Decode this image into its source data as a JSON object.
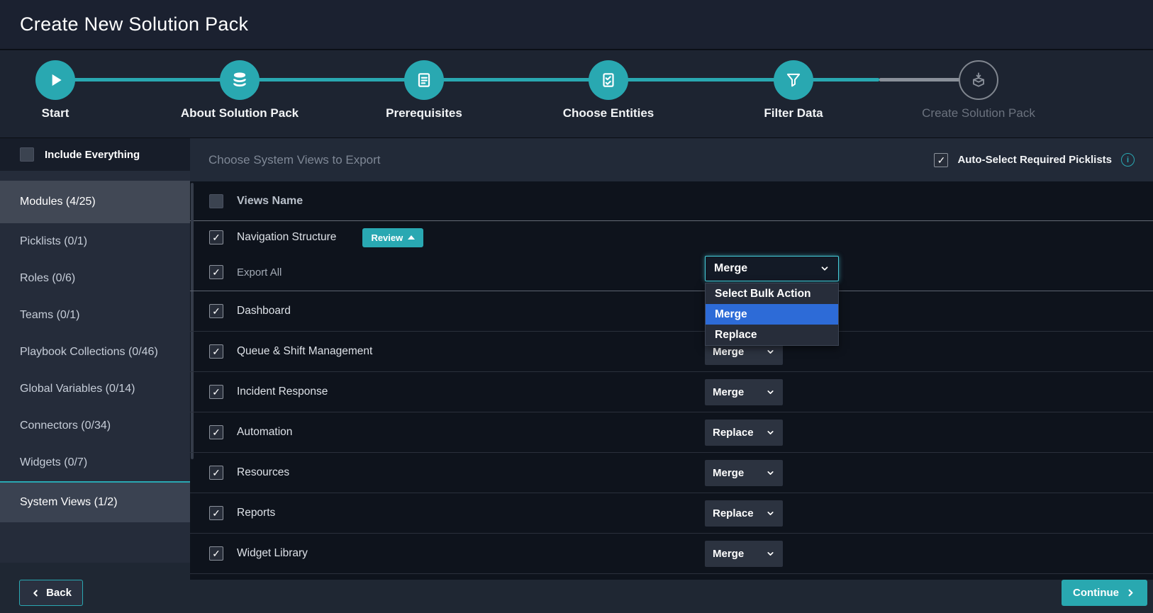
{
  "title": "Create New Solution Pack",
  "stepper": {
    "steps": [
      {
        "label": "Start",
        "icon": "play-icon",
        "state": "done"
      },
      {
        "label": "About Solution Pack",
        "icon": "database-icon",
        "state": "done"
      },
      {
        "label": "Prerequisites",
        "icon": "document-icon",
        "state": "done"
      },
      {
        "label": "Choose Entities",
        "icon": "checklist-icon",
        "state": "done"
      },
      {
        "label": "Filter Data",
        "icon": "funnel-icon",
        "state": "active"
      },
      {
        "label": "Create Solution Pack",
        "icon": "package-icon",
        "state": "pending"
      }
    ]
  },
  "sidebar": {
    "include_everything": {
      "label": "Include Everything",
      "checked": false
    },
    "items": [
      {
        "label": "Modules (4/25)",
        "state": "highlighted"
      },
      {
        "label": "Picklists (0/1)",
        "state": "normal"
      },
      {
        "label": "Roles (0/6)",
        "state": "normal"
      },
      {
        "label": "Teams (0/1)",
        "state": "normal"
      },
      {
        "label": "Playbook Collections (0/46)",
        "state": "normal"
      },
      {
        "label": "Global Variables (0/14)",
        "state": "normal"
      },
      {
        "label": "Connectors (0/34)",
        "state": "normal"
      },
      {
        "label": "Widgets (0/7)",
        "state": "normal"
      },
      {
        "label": "System Views (1/2)",
        "state": "active"
      }
    ]
  },
  "panel": {
    "heading": "Choose System Views to Export",
    "auto_select": {
      "label": "Auto-Select Required Picklists",
      "checked": true
    },
    "table_header": {
      "views_name": "Views Name",
      "checked": false
    },
    "navigation_row": {
      "label": "Navigation Structure",
      "checked": true,
      "review_label": "Review"
    },
    "export_all_row": {
      "label": "Export All",
      "checked": true,
      "selected_action": "Merge"
    },
    "bulk_menu": {
      "options": [
        "Select Bulk Action",
        "Merge",
        "Replace"
      ],
      "highlighted": "Merge"
    },
    "rows": [
      {
        "label": "Dashboard",
        "checked": true,
        "action": "Merge"
      },
      {
        "label": "Queue & Shift Management",
        "checked": true,
        "action": "Merge"
      },
      {
        "label": "Incident Response",
        "checked": true,
        "action": "Merge"
      },
      {
        "label": "Automation",
        "checked": true,
        "action": "Replace"
      },
      {
        "label": "Resources",
        "checked": true,
        "action": "Merge"
      },
      {
        "label": "Reports",
        "checked": true,
        "action": "Replace"
      },
      {
        "label": "Widget Library",
        "checked": true,
        "action": "Merge"
      }
    ]
  },
  "footer": {
    "back_label": "Back",
    "continue_label": "Continue"
  },
  "colors": {
    "accent": "#29a8b1",
    "menu_highlight": "#2d6bd7",
    "step_pending": "#8a909a"
  }
}
